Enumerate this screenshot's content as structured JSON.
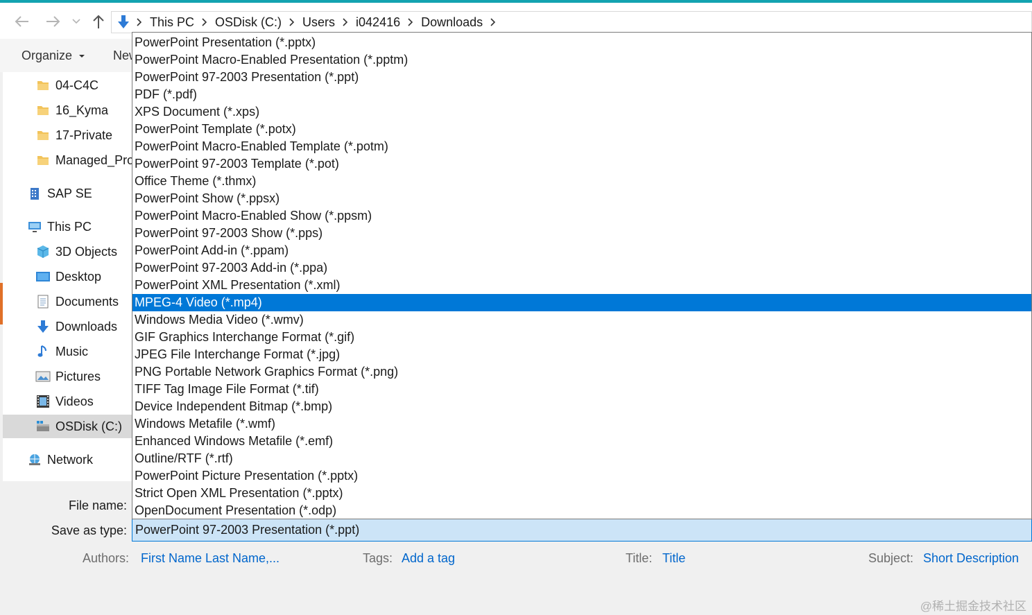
{
  "address_bar": {
    "crumbs": [
      "This PC",
      "OSDisk (C:)",
      "Users",
      "i042416",
      "Downloads"
    ]
  },
  "toolbar": {
    "organize_label": "Organize",
    "new_folder_label": "New"
  },
  "nav_pane": {
    "items": [
      {
        "label": "04-C4C",
        "icon": "folder-icon"
      },
      {
        "label": "16_Kyma",
        "icon": "folder-icon"
      },
      {
        "label": "17-Private",
        "icon": "folder-icon"
      },
      {
        "label": "Managed_Projects",
        "icon": "folder-icon"
      },
      {
        "label": "SAP SE",
        "icon": "building-icon"
      },
      {
        "label": "This PC",
        "icon": "computer-icon"
      },
      {
        "label": "3D Objects",
        "icon": "cube-icon"
      },
      {
        "label": "Desktop",
        "icon": "desktop-icon"
      },
      {
        "label": "Documents",
        "icon": "document-icon"
      },
      {
        "label": "Downloads",
        "icon": "download-icon"
      },
      {
        "label": "Music",
        "icon": "music-icon"
      },
      {
        "label": "Pictures",
        "icon": "pictures-icon"
      },
      {
        "label": "Videos",
        "icon": "videos-icon"
      },
      {
        "label": "OSDisk (C:)",
        "icon": "drive-icon"
      },
      {
        "label": "Network",
        "icon": "network-icon"
      }
    ]
  },
  "save_type_dropdown": {
    "options": [
      "PowerPoint Presentation (*.pptx)",
      "PowerPoint Macro-Enabled Presentation (*.pptm)",
      "PowerPoint 97-2003 Presentation (*.ppt)",
      "PDF (*.pdf)",
      "XPS Document (*.xps)",
      "PowerPoint Template (*.potx)",
      "PowerPoint Macro-Enabled Template (*.potm)",
      "PowerPoint 97-2003 Template (*.pot)",
      "Office Theme (*.thmx)",
      "PowerPoint Show (*.ppsx)",
      "PowerPoint Macro-Enabled Show (*.ppsm)",
      "PowerPoint 97-2003 Show (*.pps)",
      "PowerPoint Add-in (*.ppam)",
      "PowerPoint 97-2003 Add-in (*.ppa)",
      "PowerPoint XML Presentation (*.xml)",
      "MPEG-4 Video (*.mp4)",
      "Windows Media Video (*.wmv)",
      "GIF Graphics Interchange Format (*.gif)",
      "JPEG File Interchange Format (*.jpg)",
      "PNG Portable Network Graphics Format (*.png)",
      "TIFF Tag Image File Format (*.tif)",
      "Device Independent Bitmap (*.bmp)",
      "Windows Metafile (*.wmf)",
      "Enhanced Windows Metafile (*.emf)",
      "Outline/RTF (*.rtf)",
      "PowerPoint Picture Presentation (*.pptx)",
      "Strict Open XML Presentation (*.pptx)",
      "OpenDocument Presentation (*.odp)"
    ],
    "highlighted": "MPEG-4 Video (*.mp4)"
  },
  "form": {
    "file_name_label": "File name:",
    "save_as_type_label": "Save as type:",
    "save_as_type_value": "PowerPoint 97-2003 Presentation (*.ppt)"
  },
  "metadata": {
    "authors_label": "Authors:",
    "authors_value": "First Name Last Name,...",
    "tags_label": "Tags:",
    "tags_value": "Add a tag",
    "title_label": "Title:",
    "title_value": "Title",
    "subject_label": "Subject:",
    "subject_value": "Short Description"
  },
  "watermark": "@稀土掘金技术社区",
  "colors": {
    "accent": "#13a3b0",
    "highlight": "#0078d7",
    "selection_fill": "#cce4f7",
    "link": "#0066cc",
    "folder": "#f2c35a"
  }
}
